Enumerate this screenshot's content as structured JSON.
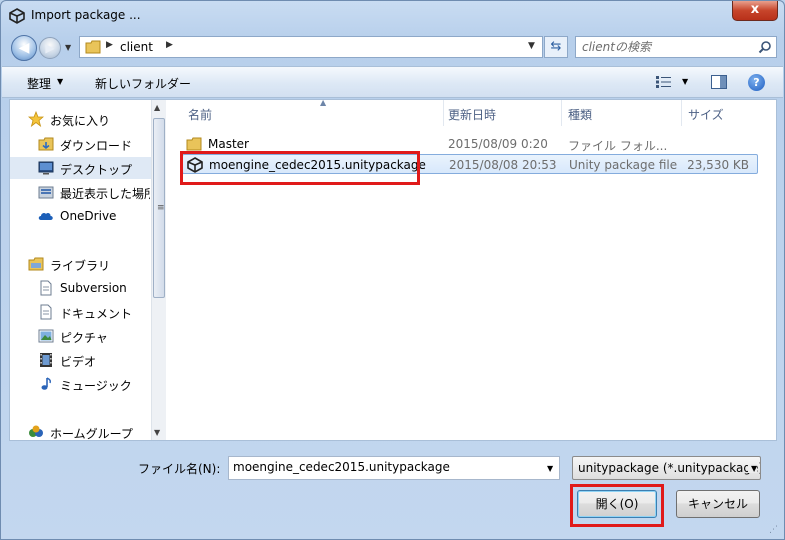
{
  "window": {
    "title": "Import package ...",
    "close_label": "x"
  },
  "address": {
    "path_segment": "client"
  },
  "search": {
    "placeholder": "clientの検索"
  },
  "toolbar": {
    "organize_label": "整理",
    "new_folder_label": "新しいフォルダー"
  },
  "sidebar": {
    "items": [
      {
        "label": "お気に入り",
        "icon": "star-icon"
      },
      {
        "label": "ダウンロード",
        "icon": "download-folder-icon"
      },
      {
        "label": "デスクトップ",
        "icon": "desktop-icon"
      },
      {
        "label": "最近表示した場所",
        "icon": "recent-places-icon"
      },
      {
        "label": "OneDrive",
        "icon": "cloud-icon"
      },
      {
        "label": "ライブラリ",
        "icon": "library-icon"
      },
      {
        "label": "Subversion",
        "icon": "document-icon"
      },
      {
        "label": "ドキュメント",
        "icon": "document-icon"
      },
      {
        "label": "ピクチャ",
        "icon": "picture-icon"
      },
      {
        "label": "ビデオ",
        "icon": "video-icon"
      },
      {
        "label": "ミュージック",
        "icon": "music-icon"
      },
      {
        "label": "ホームグループ",
        "icon": "homegroup-icon"
      }
    ]
  },
  "columns": {
    "name": "名前",
    "date": "更新日時",
    "type": "種類",
    "size": "サイズ"
  },
  "files": [
    {
      "name": "Master",
      "date": "2015/08/09 0:20",
      "type": "ファイル フォル...",
      "size": ""
    },
    {
      "name": "moengine_cedec2015.unitypackage",
      "date": "2015/08/08 20:53",
      "type": "Unity package file",
      "size": "23,530 KB"
    }
  ],
  "bottom": {
    "filename_label": "ファイル名(N):",
    "filename_value": "moengine_cedec2015.unitypackage",
    "filetype_value": "unitypackage (*.unitypackage)",
    "open_label": "開く(O)",
    "cancel_label": "キャンセル"
  },
  "colors": {
    "highlight": "#e01a1a",
    "selection": "#d8e8fb"
  }
}
